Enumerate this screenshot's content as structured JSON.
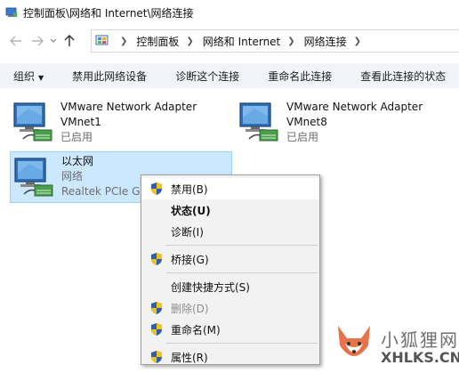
{
  "window": {
    "title": "控制面板\\网络和 Internet\\网络连接"
  },
  "nav": {
    "back_icon": "arrow-left-icon",
    "forward_icon": "arrow-right-icon",
    "up_icon": "arrow-up-icon"
  },
  "address": {
    "crumbs": [
      "控制面板",
      "网络和 Internet",
      "网络连接"
    ]
  },
  "toolbar": {
    "organize": "组织",
    "disable_device": "禁用此网络设备",
    "diagnose": "诊断这个连接",
    "rename": "重命名此连接",
    "view_status": "查看此连接的状态"
  },
  "adapters": [
    {
      "name": "VMware Network Adapter",
      "device": "VMnet1",
      "status": "已启用"
    },
    {
      "name": "VMware Network Adapter",
      "device": "VMnet8",
      "status": "已启用"
    },
    {
      "name": "以太网",
      "device": "网络",
      "status": "Realtek PCIe Gb"
    }
  ],
  "context_menu": {
    "items": [
      {
        "label": "禁用(B)",
        "shield": true
      },
      {
        "label": "状态(U)",
        "bold": true
      },
      {
        "label": "诊断(I)"
      },
      {
        "label": "桥接(G)",
        "shield": true
      },
      {
        "label": "创建快捷方式(S)"
      },
      {
        "label": "删除(D)",
        "shield": true,
        "disabled": true
      },
      {
        "label": "重命名(M)",
        "shield": true
      },
      {
        "label": "属性(R)",
        "shield": true
      }
    ]
  },
  "watermark": {
    "cn": "小狐狸网",
    "en": "XHLKS.CN"
  },
  "colors": {
    "selection_bg": "#cce8ff",
    "selection_border": "#99d1ff",
    "toolbar_bg": "#f0f4f9",
    "menu_bg": "#f2f2f2"
  }
}
